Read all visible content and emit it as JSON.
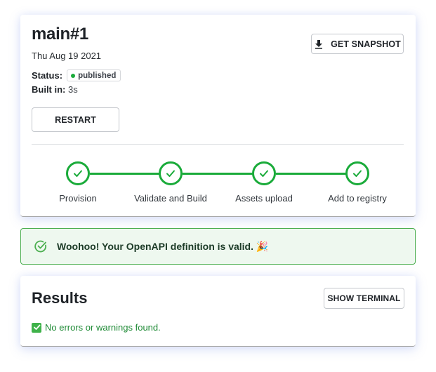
{
  "build": {
    "title": "main#1",
    "date": "Thu Aug 19 2021",
    "status_label": "Status:",
    "status_value": "published",
    "built_in_label": "Built in:",
    "built_in_value": "3s",
    "restart_label": "RESTART",
    "snapshot_label": "GET SNAPSHOT",
    "snapshot_icon": "download-icon"
  },
  "steps": [
    {
      "label": "Provision",
      "state": "complete"
    },
    {
      "label": "Validate and Build",
      "state": "complete"
    },
    {
      "label": "Assets upload",
      "state": "complete"
    },
    {
      "label": "Add to registry",
      "state": "complete"
    }
  ],
  "alert": {
    "icon": "check-circle-icon",
    "text": "Woohoo! Your OpenAPI definition is valid. 🎉"
  },
  "results": {
    "title": "Results",
    "terminal_label": "SHOW TERMINAL",
    "message_icon": "check-box-icon",
    "message": "No errors or warnings found."
  },
  "colors": {
    "success": "#1aab3a",
    "alert_bg": "#eef8ef",
    "alert_border": "#4caf50",
    "results_text": "#1e8a35"
  }
}
